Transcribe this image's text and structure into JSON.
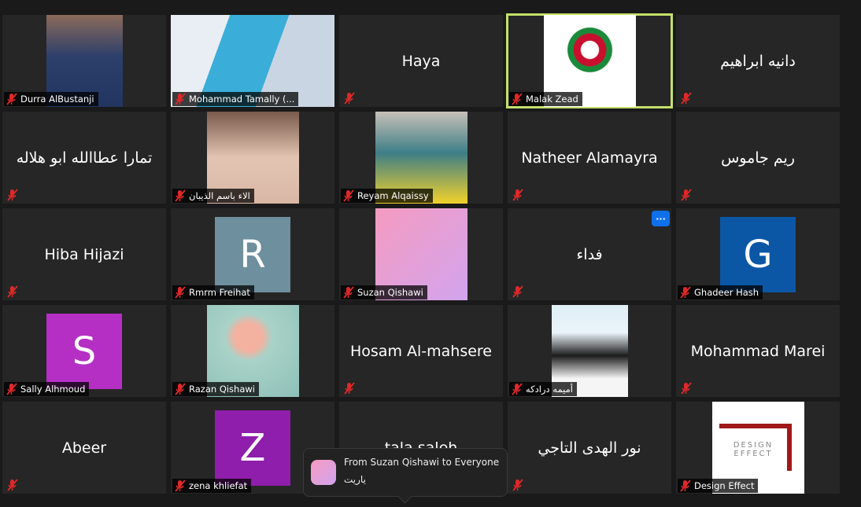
{
  "tiles": [
    {
      "label": "Durra AlBustanji",
      "kind": "image",
      "img": "linear-gradient(#8b6a5a,#2d3f6b 45%,#223560)",
      "imgx": [
        58,
        97
      ]
    },
    {
      "label": "Mohammad Tamally (...",
      "kind": "video",
      "img": "linear-gradient(110deg,#e8eef3 0 30%,#3aaed8 30% 60%,#c9d5e3 60%)"
    },
    {
      "name": "Haya",
      "kind": "text"
    },
    {
      "label": "Malak Zead",
      "kind": "image",
      "img": "radial-gradient(circle at 50% 38%,#fff 0 12%,#c8102e 13% 22%,#1a8a3a 23% 30%,#fff 31%)",
      "imgx": [
        47,
        117
      ],
      "active": true
    },
    {
      "name": "دانيه ابراهيم",
      "kind": "text"
    },
    {
      "name": "تمارا عطاالله ابو هلاله",
      "kind": "text"
    },
    {
      "label": "الاء باسم الذيبان",
      "kind": "image",
      "img": "linear-gradient(#7a5a4a,#e3c4b2 50%,#d9b7a6)",
      "imgx": [
        45,
        117
      ]
    },
    {
      "label": "Reyam Alqaissy",
      "kind": "image",
      "img": "linear-gradient(#c7c0b8,#3e7e86 45%,#f2d22b)",
      "imgx": [
        45,
        117
      ]
    },
    {
      "name": "Natheer Alamayra",
      "kind": "text"
    },
    {
      "name": "ريم جاموس",
      "kind": "text"
    },
    {
      "name": "Hiba Hijazi",
      "kind": "text"
    },
    {
      "label": "Rmrm Freihat",
      "kind": "avatar",
      "letter": "R",
      "color": "#6e8f9d"
    },
    {
      "label": "Suzan Qishawi",
      "kind": "image",
      "img": "linear-gradient(135deg,#f59bc0,#d2a4ee)",
      "imgx": [
        45,
        117
      ]
    },
    {
      "name": "فداء",
      "kind": "text",
      "more": "···"
    },
    {
      "label": "Ghadeer Hash",
      "kind": "avatar",
      "letter": "G",
      "color": "#0b57a6"
    },
    {
      "label": "Sally Alhmoud",
      "kind": "avatar",
      "letter": "S",
      "color": "#b52fc4"
    },
    {
      "label": "Razan Qishawi",
      "kind": "image",
      "img": "radial-gradient(circle at 45% 35%,#f3b2a0 0 18%,#a9d2c8 30%,#8ec0b8)",
      "imgx": [
        45,
        117
      ]
    },
    {
      "name": "Hosam Al-mahsere",
      "kind": "text"
    },
    {
      "label": "أميمه درادكه",
      "kind": "image",
      "img": "linear-gradient(#dfeef6,#eaf4fa 30%,#1c1c1c 55%,#f5f5f5 80%)",
      "imgx": [
        55,
        97
      ]
    },
    {
      "name": "Mohammad Marei",
      "kind": "text"
    },
    {
      "name": "Abeer",
      "kind": "text"
    },
    {
      "label": "zena khliefat",
      "kind": "avatar",
      "letter": "Z",
      "color": "#8e1eab"
    },
    {
      "name": "tala saleh",
      "kind": "text"
    },
    {
      "name": "نور الهدى التاجي",
      "kind": "text"
    },
    {
      "label": "Design Effect",
      "kind": "image",
      "img": "linear-gradient(#fff,#fff)",
      "imgx": [
        45,
        117
      ],
      "logo": "DESIGN EFFECT"
    }
  ],
  "chat_toast": {
    "from": "From Suzan Qishawi to Everyone",
    "message": "ياريت"
  },
  "icons": {
    "mute": "microphone-muted-icon",
    "more": "more-options-icon"
  },
  "colors": {
    "active_speaker": "#c5e06a",
    "mute": "#e02828",
    "accent": "#0e71eb"
  }
}
